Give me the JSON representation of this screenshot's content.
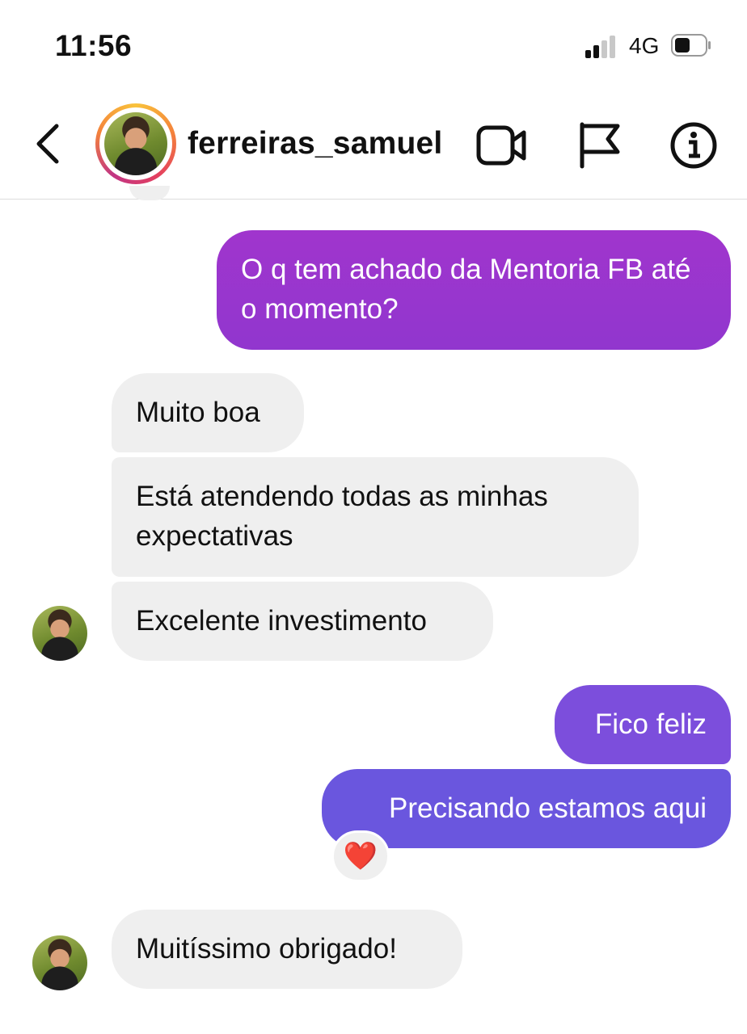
{
  "status_bar": {
    "time": "11:56",
    "network": "4G",
    "signal_bars_filled": 2,
    "signal_bars_total": 4,
    "battery_level": 0.45
  },
  "header": {
    "username": "ferreiras_samuel",
    "icons": [
      "back-chevron-icon",
      "video-call-icon",
      "flag-icon",
      "info-icon"
    ]
  },
  "messages": [
    {
      "from": "me",
      "text": "O q tem achado da Mentoria FB até o momento?"
    },
    {
      "from": "them",
      "text": "Muito boa"
    },
    {
      "from": "them",
      "text": "Está atendendo todas as minhas expectativas"
    },
    {
      "from": "them",
      "text": "Excelente investimento"
    },
    {
      "from": "me",
      "text": "Fico feliz"
    },
    {
      "from": "me",
      "text": "Precisando estamos aqui",
      "reaction": "❤️"
    },
    {
      "from": "them",
      "text": "Muitíssimo obrigado!"
    }
  ],
  "colors": {
    "me_bubble_top": "#9b36cc",
    "me_bubble_mid": "#7b4fdc",
    "me_bubble_bottom": "#6a56de",
    "them_bubble": "#efefef"
  }
}
